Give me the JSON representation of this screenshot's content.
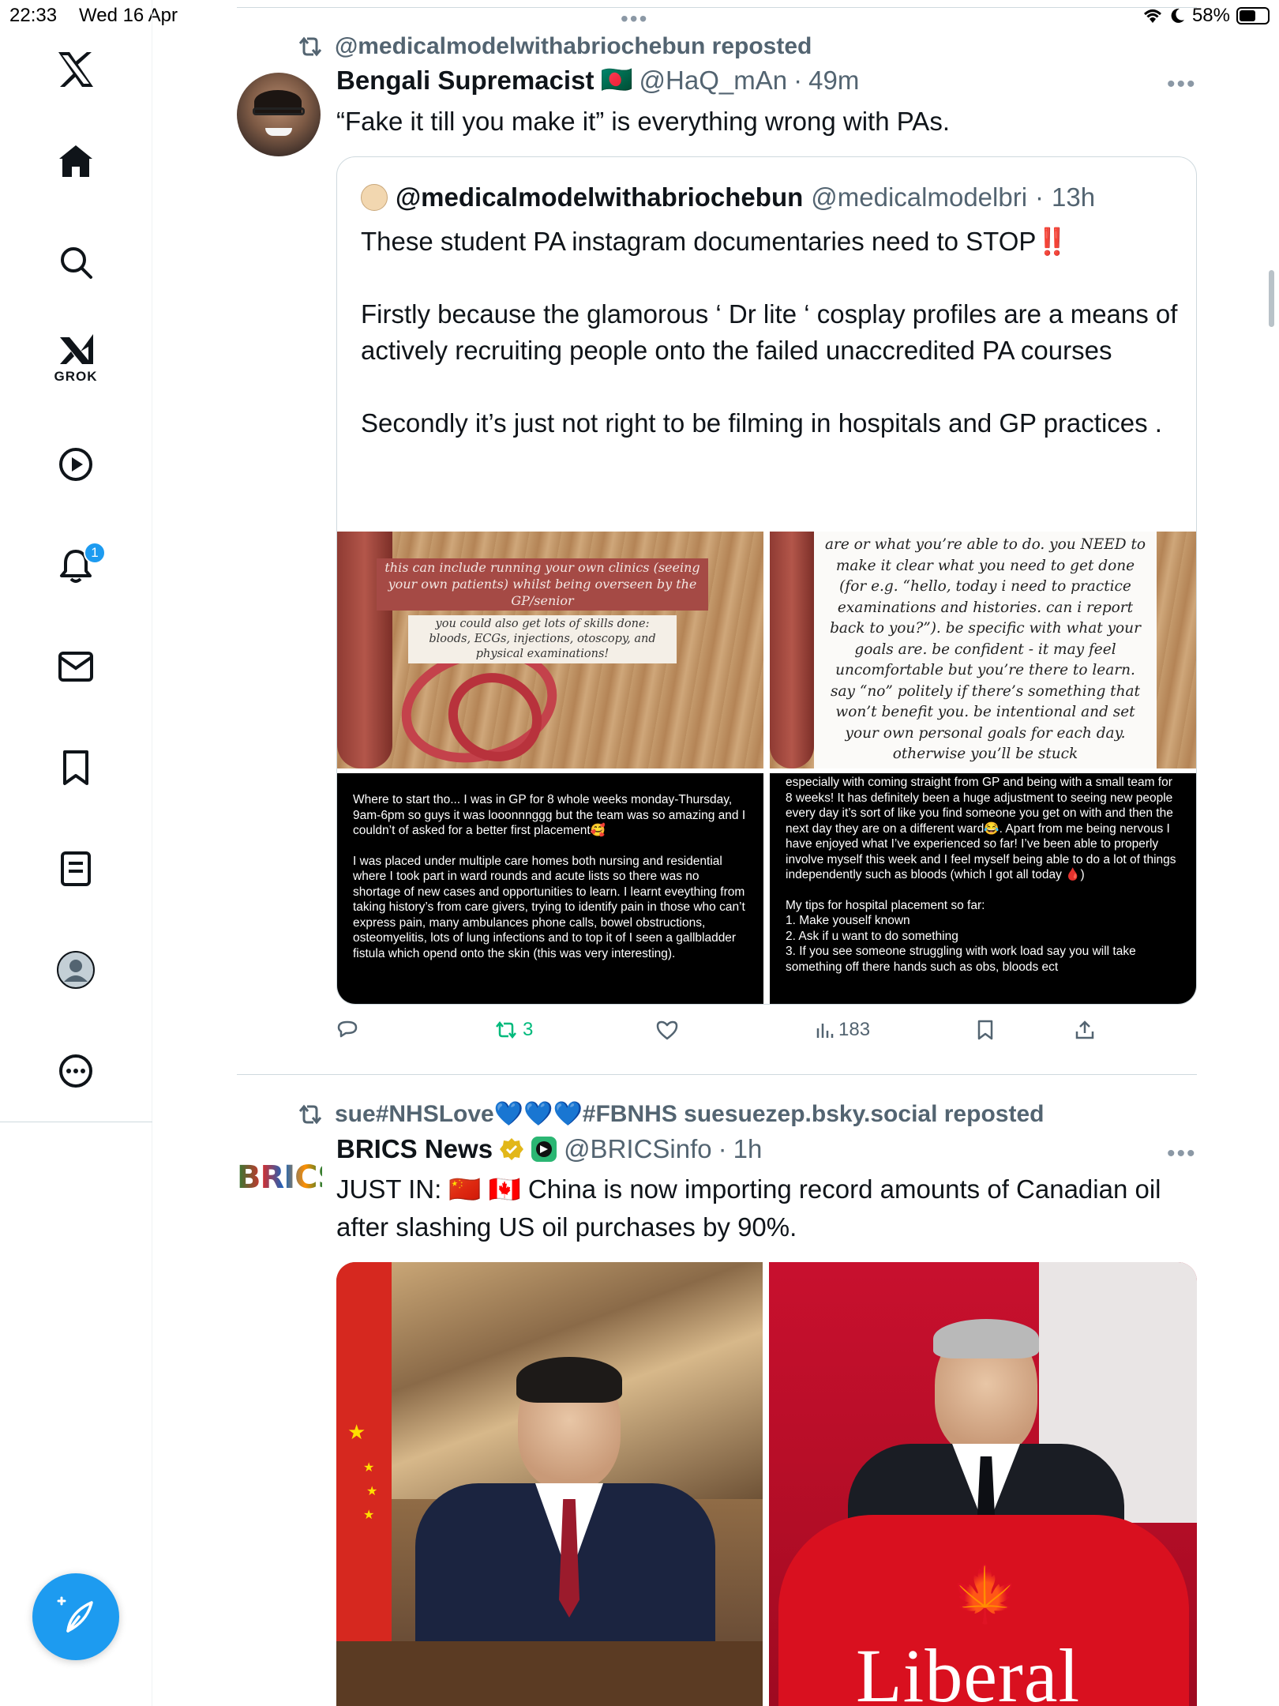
{
  "status_bar": {
    "time": "22:33",
    "date": "Wed 16 Apr",
    "battery_percent": 58,
    "battery_label": "58%"
  },
  "sidebar": {
    "items": [
      {
        "name": "x-logo-icon"
      },
      {
        "name": "home-icon"
      },
      {
        "name": "search-icon"
      },
      {
        "name": "grok-icon",
        "label": "GROK"
      },
      {
        "name": "video-icon"
      },
      {
        "name": "notifications-icon",
        "badge": "1"
      },
      {
        "name": "messages-icon"
      },
      {
        "name": "bookmarks-icon"
      },
      {
        "name": "lists-icon"
      },
      {
        "name": "profile-icon"
      },
      {
        "name": "more-icon"
      }
    ],
    "compose_icon": "compose-icon",
    "accent": "#1d9bf0"
  },
  "post1": {
    "reposted_by": "@medicalmodelwithabriochebun reposted",
    "name": "Bengali Supremacist",
    "flag": "🇧🇩",
    "handle": "@HaQ_mAn",
    "sep": "·",
    "time": "49m",
    "text": "“Fake it till you make it” is everything wrong with PAs.",
    "quote": {
      "name": "@medicalmodelwithabriochebun",
      "handle": "@medicalmodelbri",
      "sep": "·",
      "time": "13h",
      "line1": "These student PA instagram documentaries need to STOP",
      "bangbang": "‼️",
      "para2": "Firstly because the glamorous  ‘ Dr lite ‘ cosplay profiles are a means of actively recruiting people onto the failed unaccredited PA courses",
      "para3": "Secondly it’s just not right to be filming in hospitals and GP practices .",
      "img1_caption1": "this can include running your own clinics (seeing your own patients) whilst being overseen by the GP/senior",
      "img1_caption2": "you could also get lots of skills done: bloods, ECGs, injections, otoscopy, and physical examinations!",
      "img2_notes": "are or what you’re able to do. you NEED to make it clear what you need to get done (for e.g. “hello, today i need to practice examinations and histories. can i report back to you?”). be specific with what your goals are. be confident - it may feel uncomfortable but you’re there to learn. say “no” politely if there’s something that won’t benefit you. be intentional and set your own personal goals for each day. otherwise you’ll be stuck shadowing/observing when your job as a PA student is to get hands-",
      "img3_p1": "Where to start tho... I was in GP for 8 whole weeks monday-Thursday, 9am-6pm so guys it was looonnnggg but the team was so amazing and I couldn’t of asked for a better first placement🥰",
      "img3_p2": "I was placed under multiple care homes both nursing and residential where I took part in ward rounds and acute lists so there was no shortage of new cases and opportunities to learn. I learnt eveything from taking history’s from care givers, trying to identify pain in those who can’t express pain, many ambulances phone calls, bowel obstructions, osteomyelitis, lots of lung infections and to top it of I seen a gallbladder fistula which opend onto the skin (this was very interesting).",
      "img4_p1": "especially with coming straight from GP and being with a small team for 8 weeks! It has definitely been a huge adjustment to seeing new people every day it’s sort of like you find someone you get on with and then the next day they are on a different ward😂. Apart from me being nervous I have enjoyed what I’ve experienced so far! I’ve been able to properly involve myself this week and I feel myself being able to do a lot of things independently such as bloods (which I got all today 🩸)",
      "img4_p2": "My tips for hospital placement so far:\n1. Make youself known\n2. Ask if u want to do something\n3. If you see someone struggling with work load say you will take something off there hands such as obs, bloods ect"
    },
    "actions": {
      "reply_icon": "reply-icon",
      "repost_count": "3",
      "like_icon": "like-icon",
      "views": "183",
      "bookmark_icon": "bookmark-icon",
      "share_icon": "share-icon"
    }
  },
  "post2": {
    "reposted_by": "sue#NHSLove💙💙💙#FBNHS suesuezep.bsky.social reposted",
    "logo_text": "BRICS",
    "name": "BRICS News",
    "handle": "@BRICSinfo",
    "sep": "·",
    "time": "1h",
    "text": "JUST IN: 🇨🇳 🇨🇦 China is now importing record amounts of Canadian oil after slashing US oil purchases by 90%.",
    "photo2_sign": "Liberal"
  }
}
